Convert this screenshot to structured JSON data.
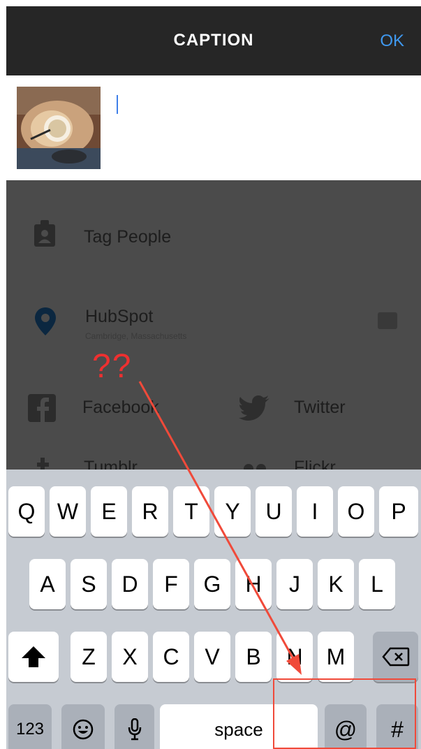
{
  "header": {
    "title": "CAPTION",
    "ok_label": "OK"
  },
  "caption": {
    "value": ""
  },
  "options": {
    "tag_people": "Tag People",
    "location": {
      "name": "HubSpot",
      "detail": "Cambridge, Massachusetts"
    },
    "share": [
      "Facebook",
      "Twitter",
      "Tumblr",
      "Flickr"
    ]
  },
  "annotation": {
    "text": "??",
    "color": "#ee3030"
  },
  "keyboard": {
    "row1": [
      "Q",
      "W",
      "E",
      "R",
      "T",
      "Y",
      "U",
      "I",
      "O",
      "P"
    ],
    "row2": [
      "A",
      "S",
      "D",
      "F",
      "G",
      "H",
      "J",
      "K",
      "L"
    ],
    "row3": [
      "Z",
      "X",
      "C",
      "V",
      "B",
      "N",
      "M"
    ],
    "bottom": {
      "numbers": "123",
      "space": "space",
      "at": "@",
      "hash": "#"
    }
  },
  "colors": {
    "accent": "#3f98ee",
    "annotation": "#f04a3a"
  }
}
